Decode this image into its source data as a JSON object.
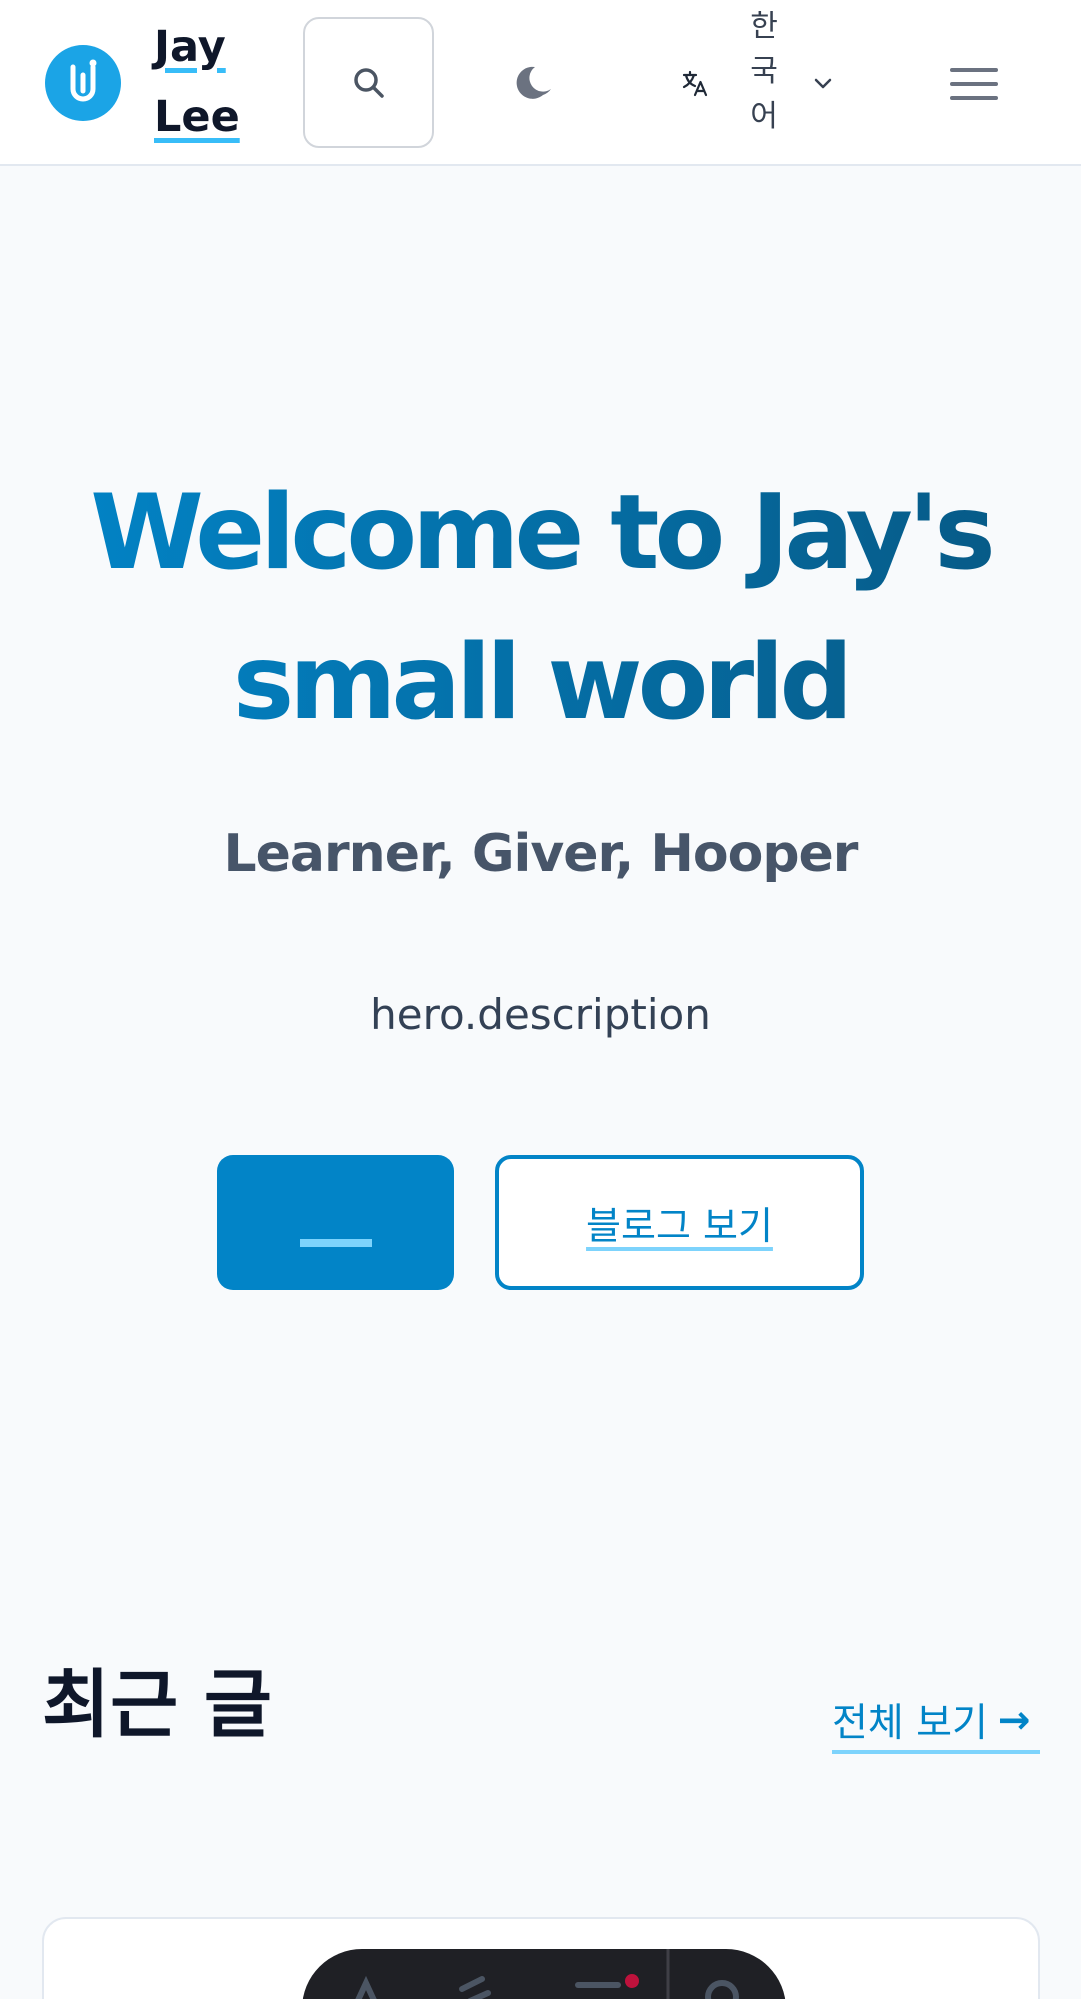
{
  "header": {
    "brand_line1": "Jay",
    "brand_line2": "Lee",
    "language_label": "한국어",
    "icons": {
      "logo": "logo-u-icon",
      "search": "search-icon",
      "theme": "moon-icon",
      "language": "translate-icon",
      "language_dropdown": "chevron-down-icon",
      "menu": "hamburger-menu-icon"
    }
  },
  "hero": {
    "title": "Welcome to Jay's small world",
    "subtitle": "Learner, Giver, Hooper",
    "description": "hero.description",
    "secondary_button": "블로그 보기"
  },
  "recent": {
    "title": "최근 글",
    "view_all": "전체 보기",
    "view_all_arrow": "→"
  },
  "colors": {
    "accent": "#0284c7",
    "accent_dark": "#075985",
    "underline": "#7dd3fc",
    "logo": "#1ba4e6",
    "background": "#f8fafc"
  }
}
